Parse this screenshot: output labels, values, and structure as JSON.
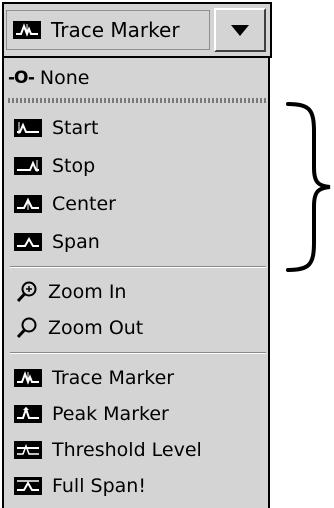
{
  "combo": {
    "selected_label": "Trace Marker",
    "icon": "trace-marker-icon"
  },
  "menu": {
    "none_glyph": "-O-",
    "none_label": "None",
    "items": [
      {
        "label": "Start",
        "icon": "start-icon"
      },
      {
        "label": "Stop",
        "icon": "stop-icon"
      },
      {
        "label": "Center",
        "icon": "center-icon"
      },
      {
        "label": "Span",
        "icon": "span-icon"
      },
      {
        "label": "Zoom In",
        "icon": "zoom-in-icon"
      },
      {
        "label": "Zoom Out",
        "icon": "zoom-out-icon"
      },
      {
        "label": "Trace Marker",
        "icon": "trace-marker-icon"
      },
      {
        "label": "Peak Marker",
        "icon": "peak-marker-icon"
      },
      {
        "label": "Threshold Level",
        "icon": "threshold-level-icon"
      },
      {
        "label": "Full Span!",
        "icon": "full-span-icon"
      }
    ]
  },
  "colors": {
    "background": "#d4d4d4",
    "border": "#000000"
  }
}
